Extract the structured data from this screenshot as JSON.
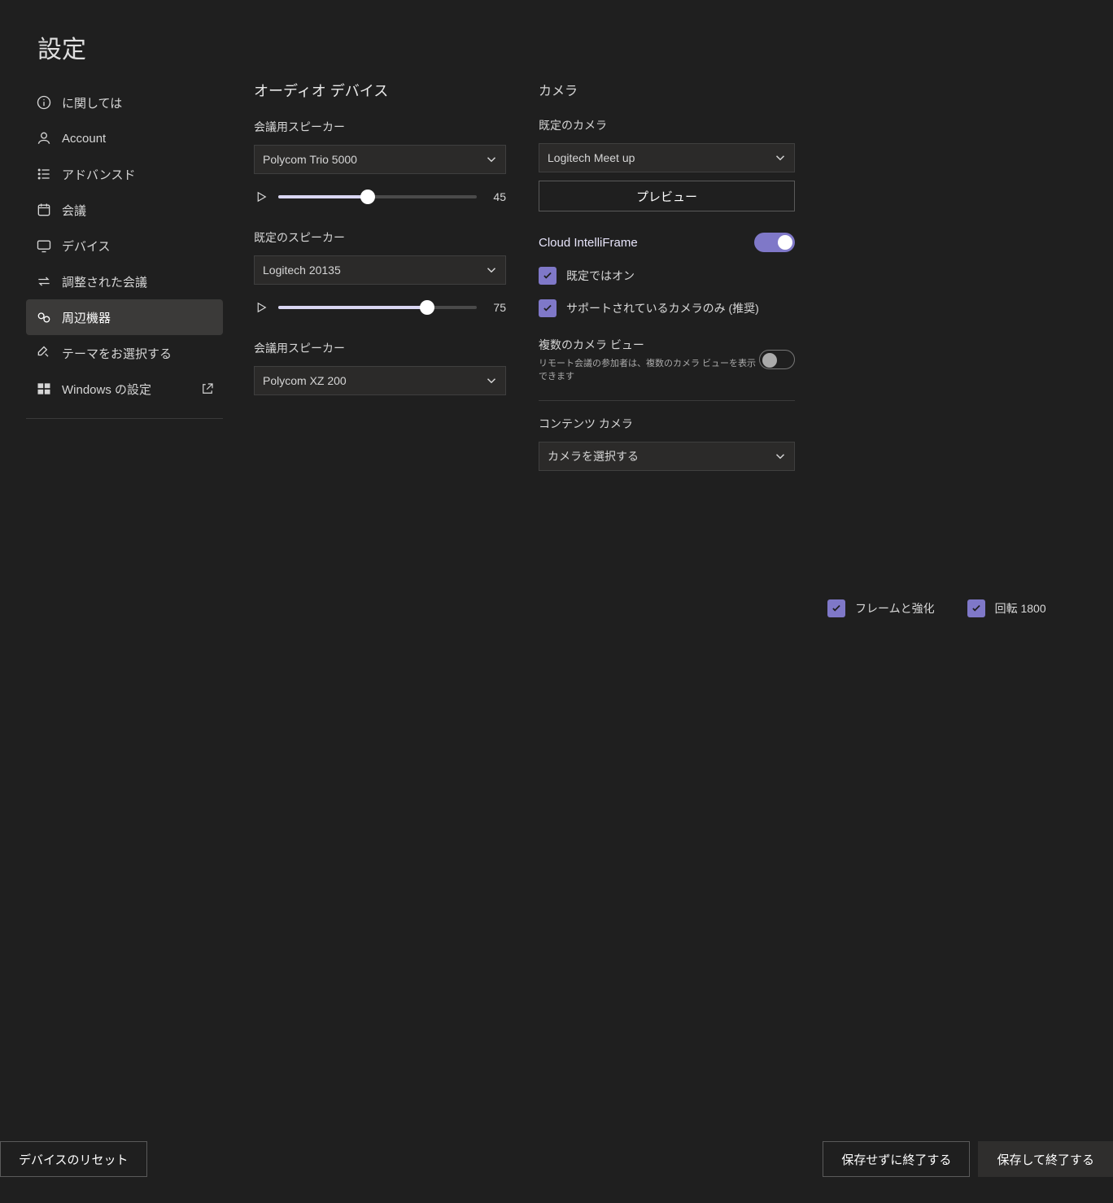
{
  "title": "設定",
  "sidebar": {
    "items": [
      {
        "label": "に関しては"
      },
      {
        "label": "Account"
      },
      {
        "label": "アドバンスド"
      },
      {
        "label": "会議"
      },
      {
        "label": "デバイス"
      },
      {
        "label": "調整された会議"
      },
      {
        "label": "周辺機器"
      },
      {
        "label": "テーマをお選択する"
      },
      {
        "label": "Windows の設定"
      }
    ]
  },
  "audio": {
    "section_title": "オーディオ デバイス",
    "speaker": {
      "label": "会議用スピーカー",
      "value": "Polycom Trio 5000",
      "volume": 45
    },
    "default_speaker": {
      "label": "既定のスピーカー",
      "value": "Logitech 20135",
      "volume": 75
    },
    "speaker2": {
      "label": "会議用スピーカー",
      "value": "Polycom XZ 200"
    }
  },
  "camera": {
    "section_title": "カメラ",
    "default": {
      "label": "既定のカメラ",
      "value": "Logitech Meet up"
    },
    "preview_button": "プレビュー",
    "intelliframe": {
      "label": "Cloud IntelliFrame",
      "on": true,
      "opt_default_on": "既定ではオン",
      "opt_supported": "サポートされているカメラのみ (推奨)"
    },
    "multiview": {
      "label": "複数のカメラ ビュー",
      "sub": "リモート会議の参加者は、複数のカメラ ビューを表示できます",
      "on": false
    },
    "content": {
      "label": "コンテンツ カメラ",
      "value": "カメラを選択する",
      "opt_frame": "フレームと強化",
      "opt_rotate": "回転 1800"
    }
  },
  "footer": {
    "reset": "デバイスのリセット",
    "exit_nosave": "保存せずに終了する",
    "exit_save": "保存して終了する"
  }
}
